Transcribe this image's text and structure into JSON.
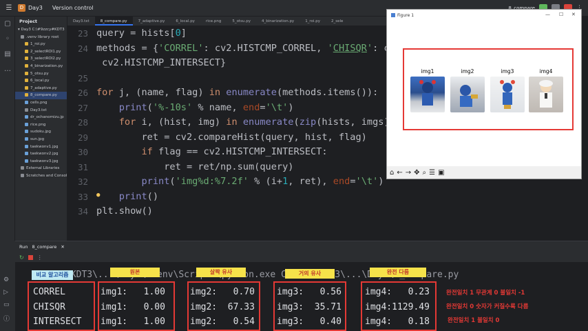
{
  "titlebar": {
    "project_initial": "D",
    "project_name": "Day3",
    "vcs": "Version control",
    "run_config": "8_compare"
  },
  "project_panel": {
    "header": "Project",
    "root": "Day3 C:\\#9zzcy#KDT3",
    "items": [
      {
        "name": ".venv library root",
        "sel": false
      },
      {
        "name": "1_roi.py",
        "sel": false
      },
      {
        "name": "2_selectROI1.py",
        "sel": false
      },
      {
        "name": "3_selectROI2.py",
        "sel": false
      },
      {
        "name": "4_binarization.py",
        "sel": false
      },
      {
        "name": "5_otsu.py",
        "sel": false
      },
      {
        "name": "6_local.py",
        "sel": false
      },
      {
        "name": "7_adaptive.py",
        "sel": false
      },
      {
        "name": "8_compare.py",
        "sel": true
      },
      {
        "name": "cells.png",
        "sel": false
      },
      {
        "name": "Day3.txt",
        "sel": false
      },
      {
        "name": "dr_ochanomizu.jp",
        "sel": false
      },
      {
        "name": "rice.png",
        "sel": false
      },
      {
        "name": "sudoku.jpg",
        "sel": false
      },
      {
        "name": "sun.jpg",
        "sel": false
      },
      {
        "name": "taekwonv1.jpg",
        "sel": false
      },
      {
        "name": "taekwonv2.jpg",
        "sel": false
      },
      {
        "name": "taekwonv3.jpg",
        "sel": false
      },
      {
        "name": "External Libraries",
        "sel": false
      },
      {
        "name": "Scratches and Consol",
        "sel": false
      }
    ]
  },
  "tabs": [
    "Day3.txt",
    "8_compare.py",
    "7_adaptive.py",
    "6_local.py",
    "rice.png",
    "5_otsu.py",
    "4_binarization.py",
    "1_roi.py",
    "2_sele"
  ],
  "line_numbers": [
    "23",
    "24",
    "",
    "25",
    "26",
    "27",
    "28",
    "29",
    "30",
    "31",
    "32",
    "33",
    "34"
  ],
  "figure": {
    "title": "Figure 1",
    "labels": [
      "img1",
      "img2",
      "img3",
      "img4"
    ],
    "toolbar_icons": [
      "home-icon",
      "back-icon",
      "forward-icon",
      "pan-icon",
      "zoom-icon",
      "configure-icon",
      "save-icon"
    ]
  },
  "run": {
    "tab_label": "Run",
    "config": "8_compare",
    "path_line": "C:\\...\\KDT3\\...\\Day3\\.venv\\Scripts\\python.exe C:\\...\\KDT3\\...\\Day3\\8_compare.py",
    "rows": [
      {
        "method": "CORREL",
        "i1": "img1:   1.00",
        "i2": "img2:   0.70",
        "i3": "img3:   0.56",
        "i4": "img4:   0.23"
      },
      {
        "method": "CHISQR",
        "i1": "img1:   0.00",
        "i2": "img2:  67.33",
        "i3": "img3:  35.71",
        "i4": "img4:1129.49"
      },
      {
        "method": "INTERSECT",
        "i1": "img1:   1.00",
        "i2": "img2:   0.54",
        "i3": "img3:   0.40",
        "i4": "img4:   0.18"
      }
    ]
  },
  "annotations": {
    "label_algo": "비교 알고리즘",
    "label_original": "원본",
    "label_slight": "살짝 유사",
    "label_almost": "거의 유사",
    "label_different": "완전 다름",
    "note1": "완전일치 1  무관계 0 불일치  -1",
    "note2": "완전일치 0 숫자가 커질수록 다름",
    "note3": "완전일치 1 불일치 0",
    "highlight_color": "#f6e24a",
    "box_color": "#e53935"
  }
}
